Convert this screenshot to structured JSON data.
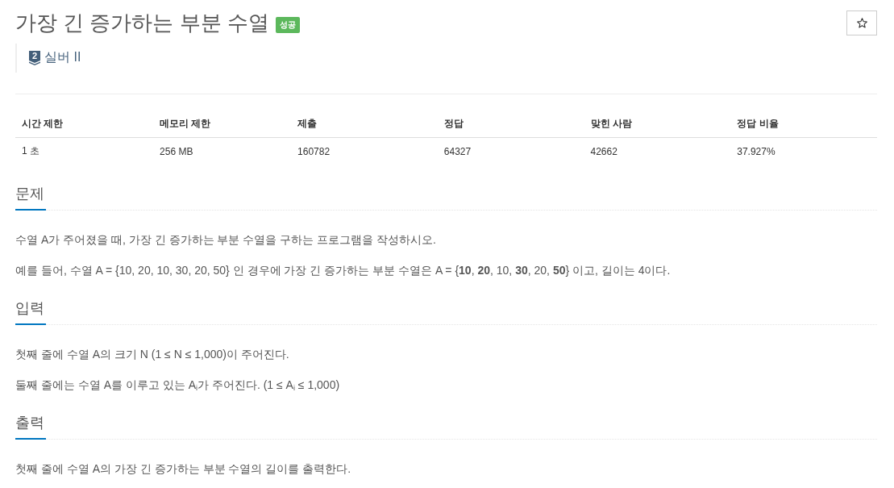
{
  "problem": {
    "title": "가장 긴 증가하는 부분 수열",
    "result_badge": "성공",
    "starred": false
  },
  "tier": {
    "number": "2",
    "label": "실버 II"
  },
  "info_table": {
    "columns": [
      "시간 제한",
      "메모리 제한",
      "제출",
      "정답",
      "맞힌 사람",
      "정답 비율"
    ],
    "rows": [
      [
        "1 초",
        "256 MB",
        "160782",
        "64327",
        "42662",
        "37.927%"
      ]
    ]
  },
  "sections": [
    {
      "heading": "문제",
      "paragraphs": [
        "수열 A가 주어졌을 때, 가장 긴 증가하는 부분 수열을 구하는 프로그램을 작성하시오.",
        "예를 들어, 수열 A = {10, 20, 10, 30, 20, 50} 인 경우에 가장 긴 증가하는 부분 수열은 A = {**10**, **20**, 10, **30**, 20, **50**} 이고, 길이는 4이다."
      ]
    },
    {
      "heading": "입력",
      "paragraphs": [
        "첫째 줄에 수열 A의 크기 N (1 ≤ N ≤ 1,000)이 주어진다.",
        "둘째 줄에는 수열 A를 이루고 있는 A$_{i}$가 주어진다. (1 ≤ A$_{i}$ ≤ 1,000)"
      ]
    },
    {
      "heading": "출력",
      "paragraphs": [
        "첫째 줄에 수열 A의 가장 긴 증가하는 부분 수열의 길이를 출력한다."
      ]
    }
  ]
}
